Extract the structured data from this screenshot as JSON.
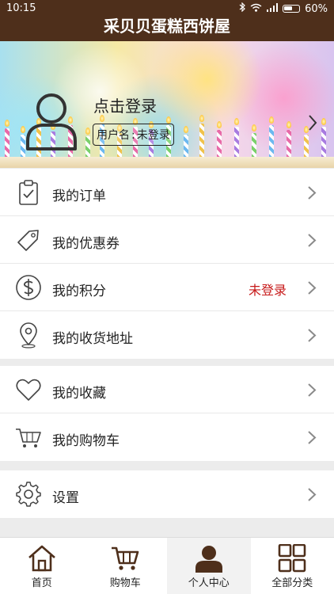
{
  "status_bar": {
    "time": "10:15",
    "battery": "60%"
  },
  "header": {
    "title": "采贝贝蛋糕西饼屋"
  },
  "profile": {
    "login_prompt": "点击登录",
    "username_label": "用户名",
    "username_sep": ":",
    "username_value": "未登录"
  },
  "menu_group_1": [
    {
      "label": "我的订单",
      "icon": "clipboard-check-icon"
    },
    {
      "label": "我的优惠券",
      "icon": "tag-icon"
    },
    {
      "label": "我的积分",
      "icon": "dollar-coin-icon",
      "status": "未登录"
    },
    {
      "label": "我的收货地址",
      "icon": "location-pin-icon"
    }
  ],
  "menu_group_2": [
    {
      "label": "我的收藏",
      "icon": "heart-icon"
    },
    {
      "label": "我的购物车",
      "icon": "cart-icon"
    }
  ],
  "menu_group_3": [
    {
      "label": "设置",
      "icon": "gear-icon"
    }
  ],
  "tabbar": [
    {
      "label": "首页",
      "icon": "home-icon"
    },
    {
      "label": "购物车",
      "icon": "cart-icon"
    },
    {
      "label": "个人中心",
      "icon": "person-icon",
      "active": true
    },
    {
      "label": "全部分类",
      "icon": "grid-icon"
    }
  ],
  "colors": {
    "header_bg": "#4e2f1b",
    "status_red": "#c71a1a",
    "text": "#222222"
  }
}
